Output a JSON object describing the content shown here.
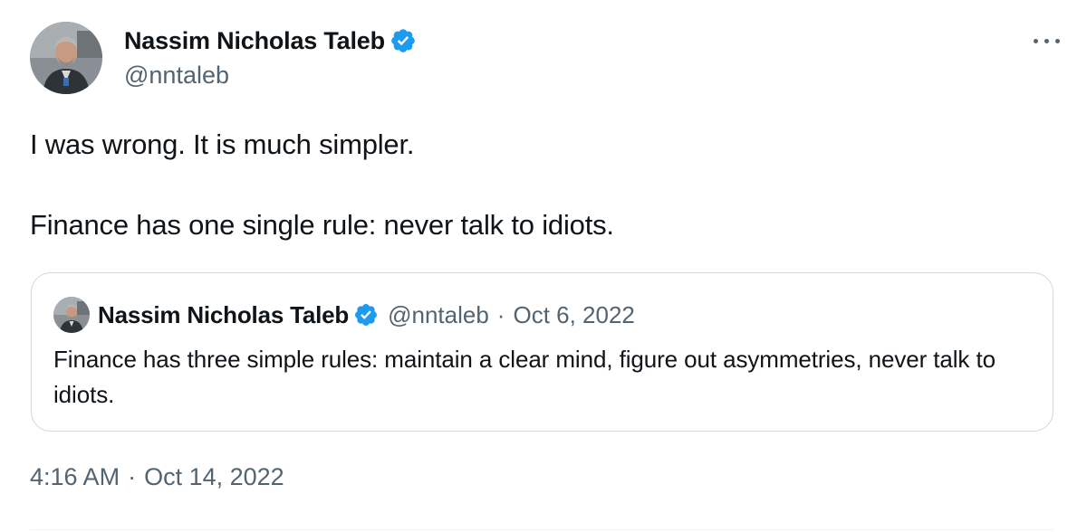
{
  "author": {
    "display_name": "Nassim Nicholas Taleb",
    "handle": "@nntaleb",
    "verified": true
  },
  "tweet": {
    "paragraphs": [
      "I was wrong. It is much simpler.",
      "Finance has one single rule: never talk to idiots."
    ],
    "time": "4:16 AM",
    "separator": "·",
    "date": "Oct 14, 2022"
  },
  "quoted_tweet": {
    "display_name": "Nassim Nicholas Taleb",
    "handle": "@nntaleb",
    "separator": "·",
    "date": "Oct 6, 2022",
    "verified": true,
    "text": "Finance has three simple rules: maintain a clear mind, figure out asymmetries, never talk to idiots."
  },
  "icons": {
    "verified": "verified-badge-icon",
    "more": "more-options-icon"
  },
  "colors": {
    "verified_blue": "#1d9bf0",
    "secondary_text": "#536471",
    "border": "#cfd9de",
    "primary_text": "#0f1419"
  }
}
